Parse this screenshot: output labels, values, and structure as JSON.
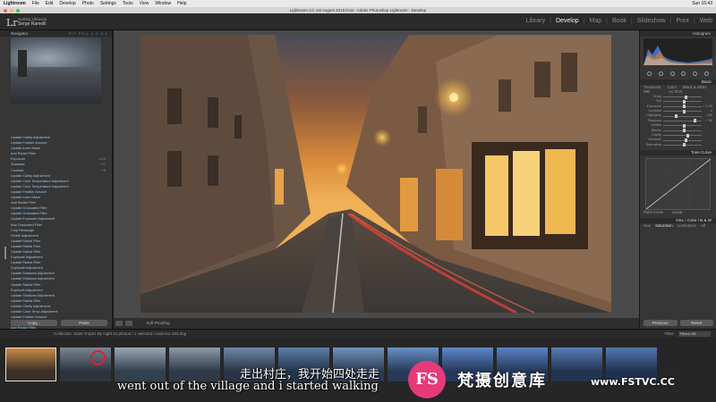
{
  "menubar": {
    "app": "Lightroom",
    "items": [
      "File",
      "Edit",
      "Develop",
      "Photo",
      "Settings",
      "Tools",
      "View",
      "Window",
      "Help"
    ],
    "clock": "Sun 16:43"
  },
  "window": {
    "title": "Lightroom CC cat August 2015.lrcat - Adobe Photoshop Lightroom - Develop"
  },
  "identity": {
    "logo": "Lr",
    "line1": "Getting Ultrastia",
    "name": "Serge Ramelli"
  },
  "modules": {
    "items": [
      "Library",
      "Develop",
      "Map",
      "Book",
      "Slideshow",
      "Print",
      "Web"
    ],
    "active": "Develop"
  },
  "left_panel": {
    "navigator_label": "Navigator",
    "zooms": "FIT FILL 1:1 3:1",
    "history": [
      {
        "label": "Update Clarity Adjustment",
        "value": ""
      },
      {
        "label": "Update Feather Amount",
        "value": ""
      },
      {
        "label": "Update Invert Mask",
        "value": ""
      },
      {
        "label": "Add Radial Filter",
        "value": ""
      },
      {
        "label": "Exposure",
        "value": "-0.10"
      },
      {
        "label": "Shadows",
        "value": "+47"
      },
      {
        "label": "Contrast",
        "value": "+8"
      },
      {
        "label": "Update Clarity Adjustment",
        "value": ""
      },
      {
        "label": "Update Color Temperature Adjustment",
        "value": ""
      },
      {
        "label": "Update Color Temperature Adjustment",
        "value": ""
      },
      {
        "label": "Update Feather Amount",
        "value": ""
      },
      {
        "label": "Update Invert Mask",
        "value": ""
      },
      {
        "label": "Add Radial Filter",
        "value": ""
      },
      {
        "label": "Update Graduated Filter",
        "value": ""
      },
      {
        "label": "Update Graduated Filter",
        "value": ""
      },
      {
        "label": "Update Exposure Adjustment",
        "value": ""
      },
      {
        "label": "Add Graduated Filter",
        "value": ""
      },
      {
        "label": "Crop Rectangle",
        "value": ""
      },
      {
        "label": "Delete Adjustment",
        "value": ""
      },
      {
        "label": "Update Radial Filter",
        "value": ""
      },
      {
        "label": "Update Radial Filter",
        "value": ""
      },
      {
        "label": "Update Radial Filter",
        "value": ""
      },
      {
        "label": "Duplicate Adjustment",
        "value": ""
      },
      {
        "label": "Update Radial Filter",
        "value": ""
      },
      {
        "label": "Duplicate Adjustment",
        "value": ""
      },
      {
        "label": "Update Shadows Adjustment",
        "value": ""
      },
      {
        "label": "Update Shadows Adjustment",
        "value": ""
      },
      {
        "label": "Update Radial Filter",
        "value": ""
      },
      {
        "label": "Duplicate Adjustment",
        "value": ""
      },
      {
        "label": "Update Shadows Adjustment",
        "value": ""
      },
      {
        "label": "Update Radial Filter",
        "value": ""
      },
      {
        "label": "Update Clarity Adjustment",
        "value": ""
      },
      {
        "label": "Update Color Temp Adjustment",
        "value": ""
      },
      {
        "label": "Update Feather Amount",
        "value": ""
      },
      {
        "label": "Update Invert Mask",
        "value": ""
      },
      {
        "label": "Add Radial Filter",
        "value": ""
      }
    ],
    "copy_label": "Copy...",
    "paste_label": "Paste"
  },
  "toolbar": {
    "soft_proofing": "Soft Proofing"
  },
  "right_panel": {
    "histogram_label": "Histogram",
    "basic_label": "Basic",
    "treatment_label": "Treatment",
    "color_label": "Color",
    "bw_label": "Black & White",
    "wb_label": "WB",
    "wb_value": "As Shot",
    "tone_label": "Tone",
    "auto_label": "Auto",
    "sliders": [
      {
        "label": "Temp",
        "pos": 0.55,
        "value": ""
      },
      {
        "label": "Tint",
        "pos": 0.5,
        "value": ""
      },
      {
        "label": "Exposure",
        "pos": 0.52,
        "value": "+ 0.05"
      },
      {
        "label": "Contrast",
        "pos": 0.5,
        "value": "0"
      },
      {
        "label": "Highlights",
        "pos": 0.3,
        "value": "- 100"
      },
      {
        "label": "Shadows",
        "pos": 0.8,
        "value": "+ 56"
      },
      {
        "label": "Whites",
        "pos": 0.5,
        "value": ""
      },
      {
        "label": "Blacks",
        "pos": 0.5,
        "value": ""
      },
      {
        "label": "Clarity",
        "pos": 0.6,
        "value": ""
      },
      {
        "label": "Vibrance",
        "pos": 0.55,
        "value": ""
      },
      {
        "label": "Saturation",
        "pos": 0.5,
        "value": ""
      }
    ],
    "tone_curve_label": "Tone Curve",
    "point_curve_label": "Point Curve",
    "point_curve_value": "Linear",
    "hsl_label": "HSL / Color / B & W",
    "hsl_tabs": [
      "Hue",
      "Saturation",
      "Luminance",
      "All"
    ],
    "previous_label": "Previous",
    "reset_label": "Reset"
  },
  "film_bar": {
    "info": "Collection: Saint Tropez By night    12 photos / 1 selected / saint-tro-183.dng",
    "filter_label": "Filter:",
    "filter_value": "Filters Off"
  },
  "subtitles": {
    "cn": "走出村庄，我开始四处走走",
    "en": "went out of the village and i started walking"
  },
  "watermark": {
    "logo": "FS",
    "cn": "梵摄创意库",
    "url": "www.FSTVC.CC"
  },
  "colors": {
    "panel": "#363636",
    "active_module": "#f2f2f2",
    "history_text": "#9fc3e0",
    "cursor_ring": "#d3243a",
    "watermark": "#e63a7a"
  }
}
